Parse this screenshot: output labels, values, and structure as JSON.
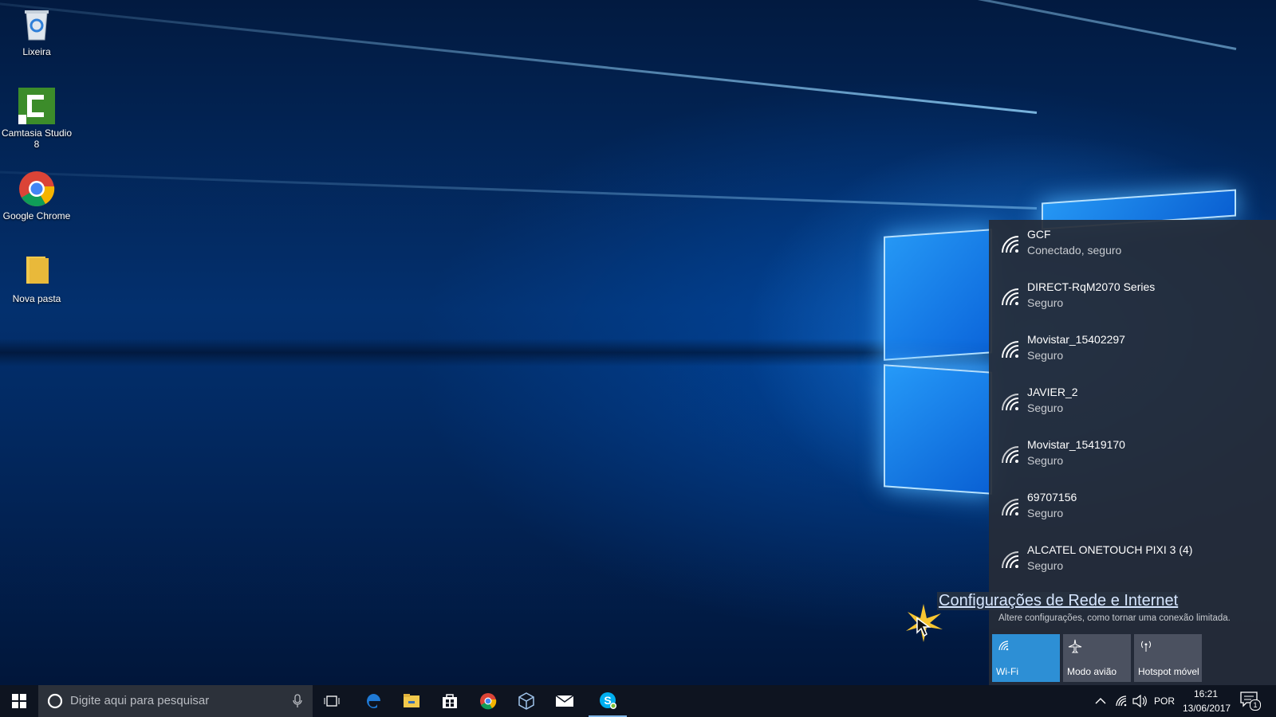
{
  "desktop": {
    "icons": [
      {
        "label": "Lixeira"
      },
      {
        "label": "Camtasia Studio 8"
      },
      {
        "label": "Google Chrome"
      },
      {
        "label": "Nova pasta"
      }
    ]
  },
  "network_flyout": {
    "networks": [
      {
        "name": "GCF",
        "status": "Conectado, seguro"
      },
      {
        "name": "DIRECT-RqM2070 Series",
        "status": "Seguro"
      },
      {
        "name": "Movistar_15402297",
        "status": "Seguro"
      },
      {
        "name": "JAVIER_2",
        "status": "Seguro"
      },
      {
        "name": "Movistar_15419170",
        "status": "Seguro"
      },
      {
        "name": "69707156",
        "status": "Seguro"
      },
      {
        "name": "ALCATEL ONETOUCH PIXI 3 (4)",
        "status": "Seguro"
      }
    ],
    "settings_link": "Configurações de Rede e Internet",
    "settings_subtext": "Altere configurações, como tornar uma conexão limitada.",
    "quick_actions": [
      {
        "label": "Wi-Fi",
        "icon": "wifi-icon",
        "active": true
      },
      {
        "label": "Modo avião",
        "icon": "airplane-icon",
        "active": false
      },
      {
        "label": "Hotspot móvel",
        "icon": "hotspot-icon",
        "active": false
      }
    ]
  },
  "taskbar": {
    "search_placeholder": "Digite aqui para pesquisar",
    "apps": [
      "task-view-icon",
      "edge-icon",
      "file-explorer-icon",
      "store-icon",
      "chrome-icon",
      "virtualbox-icon",
      "mail-icon",
      "skype-icon"
    ],
    "tray": {
      "language": "POR",
      "time": "16:21",
      "date": "13/06/2017",
      "notification_count": "1"
    }
  },
  "colors": {
    "accent": "#2d8fd5",
    "taskbar": "#0e1420",
    "flyout": "#262c38"
  }
}
